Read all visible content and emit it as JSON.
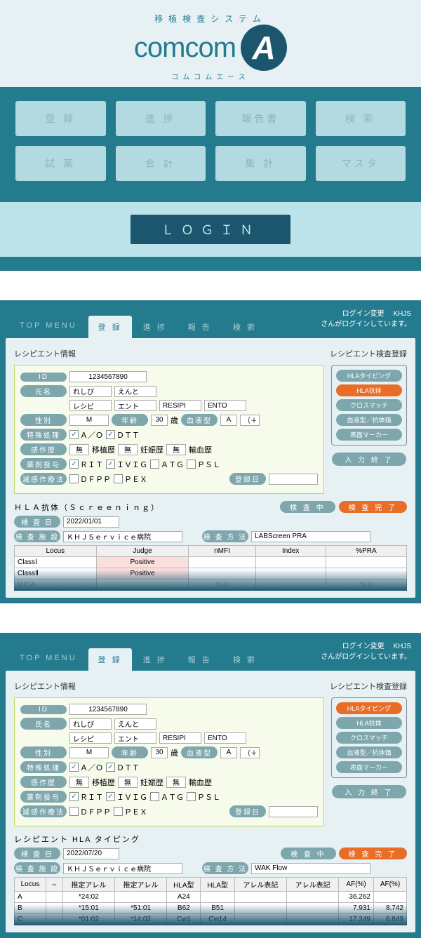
{
  "brand": {
    "top": "移植検査システム",
    "main": "comcom",
    "sub": "コムコムエース",
    "badge": "A"
  },
  "menu": [
    "登 録",
    "進 捗",
    "報告書",
    "検 索",
    "試 薬",
    "会 計",
    "集 計",
    "マスタ"
  ],
  "login_btn": "ＬＯＧＩＮ",
  "top": {
    "login_change": "ログイン変更",
    "user": "KHJS",
    "user_suffix": "さんがログインしています。"
  },
  "tabs": [
    "TOP MENU",
    "登 録",
    "進 捗",
    "報 告",
    "検 索"
  ],
  "labels": {
    "recipient_info": "レシピエント情報",
    "recipient_reg": "レシピエント検査登録",
    "id": "ID",
    "name": "氏名",
    "sex": "性別",
    "age": "年齢",
    "blood": "血液型",
    "special": "特殊処理",
    "infection": "感作歴",
    "transplant_hist": "移植歴",
    "preg_hist": "妊娠歴",
    "transfusion": "輸血歴",
    "drug": "薬剤投与",
    "plasma": "減感作療法",
    "reg_date": "登録日",
    "exam_date": "検 査 日",
    "facility": "検 査 施 設",
    "method": "検 査 方 法",
    "in_exam": "検 査 中",
    "exam_done": "検 査 完 了",
    "input_end": "入 力 終 了",
    "sai": "歳",
    "none": "無"
  },
  "recipient": {
    "id": "1234567890",
    "name1": "れしぴ",
    "name2": "えんと",
    "kana1": "レシピ",
    "kana2": "エント",
    "rom1": "RESIPI",
    "rom2": "ENTO",
    "sex": "M",
    "age": "30",
    "blood": "A",
    "rh": "（＋）",
    "ao": "Ａ／Ｏ",
    "dtt": "ＤＴＴ",
    "rit": "ＲＩＴ",
    "ivig": "ＩＶＩＧ",
    "atg": "ＡＴＧ",
    "psl": "ＰＳＬ",
    "dfpp": "ＤＦＰＰ",
    "pex": "ＰＥＸ"
  },
  "side_menu": [
    "HLAタイピング",
    "HLA抗体",
    "クロスマッチ",
    "血液型／抗体価",
    "表面マーカー"
  ],
  "panel2": {
    "section": "ＨＬＡ抗体（Ｓｃｒｅｅｎｉｎｇ）",
    "active_side": 1,
    "exam_date": "2022/01/01",
    "facility": "ＫＨＪＳｅｒｖｉｃｅ病院",
    "method": "LABScreen PRA",
    "table": {
      "headers": [
        "Locus",
        "Judge",
        "nMFI",
        "Index",
        "%PRA"
      ],
      "rows": [
        {
          "locus": "ClassⅠ",
          "judge": "Positive",
          "nmfi": "",
          "index": "",
          "pra": ""
        },
        {
          "locus": "ClassⅡ",
          "judge": "Positive",
          "nmfi": "",
          "index": "",
          "pra": ""
        },
        {
          "locus": "MICA",
          "judge": "",
          "nmfi": "N.D",
          "index": "",
          "pra": "N.D"
        }
      ]
    }
  },
  "panel3": {
    "section": "レシピエント HLA タイピング",
    "active_side": 0,
    "exam_date": "2022/07/20",
    "facility": "ＫＨＪＳｅｒｖｉｃｅ病院",
    "method": "WAK Flow",
    "table": {
      "headers": [
        "Locus",
        "⇔",
        "推定アレル",
        "推定アレル",
        "HLA型",
        "HLA型",
        "アレル表記",
        "アレル表記",
        "AF(%)",
        "AF(%)"
      ],
      "rows": [
        {
          "c": [
            "A",
            "",
            "*24:02",
            "",
            "A24",
            "",
            "",
            "",
            "36.262",
            ""
          ]
        },
        {
          "c": [
            "B",
            "",
            "*15:01",
            "*51:01",
            "B62",
            "B51",
            "",
            "",
            "7.931",
            "8.742"
          ]
        },
        {
          "c": [
            "C",
            "",
            "*01:02",
            "*14:02",
            "Cw1",
            "Cw14",
            "",
            "",
            "17.249",
            "6.849"
          ]
        }
      ]
    }
  },
  "chart_data": {
    "type": "table",
    "tables": [
      {
        "title": "HLA抗体 (Screening)",
        "headers": [
          "Locus",
          "Judge",
          "nMFI",
          "Index",
          "%PRA"
        ],
        "rows": [
          [
            "ClassⅠ",
            "Positive",
            "",
            "",
            ""
          ],
          [
            "ClassⅡ",
            "Positive",
            "",
            "",
            ""
          ],
          [
            "MICA",
            "",
            "N.D",
            "",
            "N.D"
          ]
        ]
      },
      {
        "title": "レシピエント HLA タイピング",
        "headers": [
          "Locus",
          "⇔",
          "推定アレル",
          "推定アレル",
          "HLA型",
          "HLA型",
          "アレル表記",
          "アレル表記",
          "AF(%)",
          "AF(%)"
        ],
        "rows": [
          [
            "A",
            "",
            "*24:02",
            "",
            "A24",
            "",
            "",
            "",
            "36.262",
            ""
          ],
          [
            "B",
            "",
            "*15:01",
            "*51:01",
            "B62",
            "B51",
            "",
            "",
            "7.931",
            "8.742"
          ],
          [
            "C",
            "",
            "*01:02",
            "*14:02",
            "Cw1",
            "Cw14",
            "",
            "",
            "17.249",
            "6.849"
          ]
        ]
      }
    ]
  }
}
